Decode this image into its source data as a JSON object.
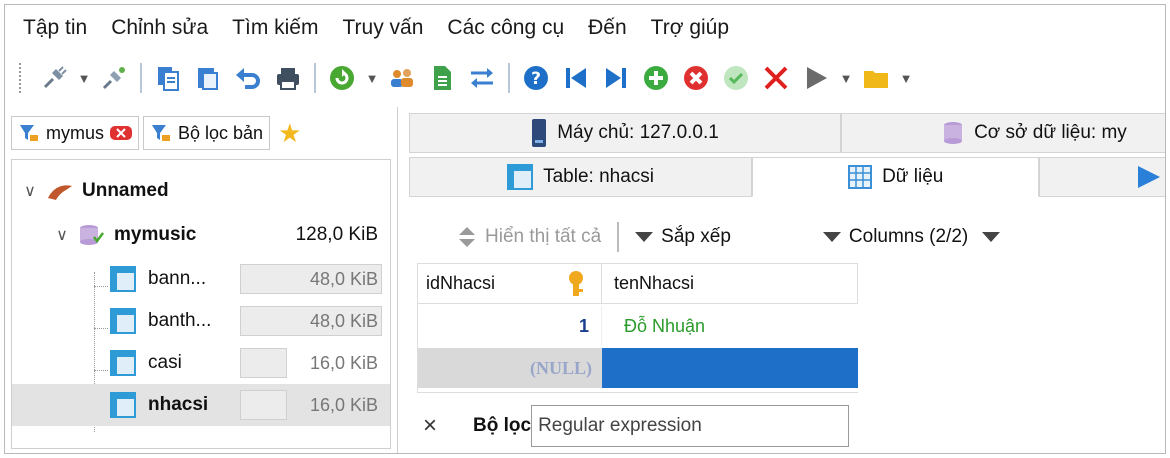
{
  "menu": [
    "Tập tin",
    "Chỉnh sửa",
    "Tìm kiếm",
    "Truy vấn",
    "Các công cụ",
    "Đến",
    "Trợ giúp"
  ],
  "toolbar_icons": [
    "plug-icon",
    "dropdown-icon",
    "disconnect-icon",
    "copy-icon",
    "paste-icon",
    "undo-icon",
    "print-icon",
    "refresh-icon",
    "dropdown-icon",
    "users-icon",
    "export-icon",
    "sync-icon",
    "help-icon",
    "first-icon",
    "last-icon",
    "add-icon",
    "delete-icon",
    "check-icon",
    "cancel-icon",
    "run-icon",
    "dropdown-icon",
    "folder-icon",
    "dropdown-icon"
  ],
  "left_tabs": {
    "session": "mymus",
    "filter": "Bộ lọc bản"
  },
  "tree": {
    "root": "Unnamed",
    "database": {
      "name": "mymusic",
      "size": "128,0 KiB"
    },
    "tables": [
      {
        "name": "bann...",
        "size": "48,0 KiB",
        "fill": 1.0
      },
      {
        "name": "banth...",
        "size": "48,0 KiB",
        "fill": 1.0
      },
      {
        "name": "casi",
        "size": "16,0 KiB",
        "fill": 0.33
      },
      {
        "name": "nhacsi",
        "size": "16,0 KiB",
        "fill": 0.33
      }
    ]
  },
  "tabs_top": {
    "host": "Máy chủ: 127.0.0.1",
    "database": "Cơ sở dữ liệu: my"
  },
  "tabs_bottom": {
    "table": "Table: nhacsi",
    "data": "Dữ liệu"
  },
  "data_toolbar": {
    "show_all": "Hiển thị tất cả",
    "sort": "Sắp xếp",
    "columns": "Columns (2/2)"
  },
  "grid": {
    "columns": [
      "idNhacsi",
      "tenNhacsi"
    ],
    "rows": [
      [
        "1",
        "Đỗ Nhuận"
      ],
      [
        "(NULL)",
        ""
      ]
    ]
  },
  "filter": {
    "close": "×",
    "label": "Bộ lọc",
    "placeholder": "Regular expression"
  },
  "colors": {
    "accent_blue": "#1e6fc8",
    "green_text": "#2a9b2a",
    "null_text": "#9aa6c9",
    "selection": "#1e6fc8"
  }
}
